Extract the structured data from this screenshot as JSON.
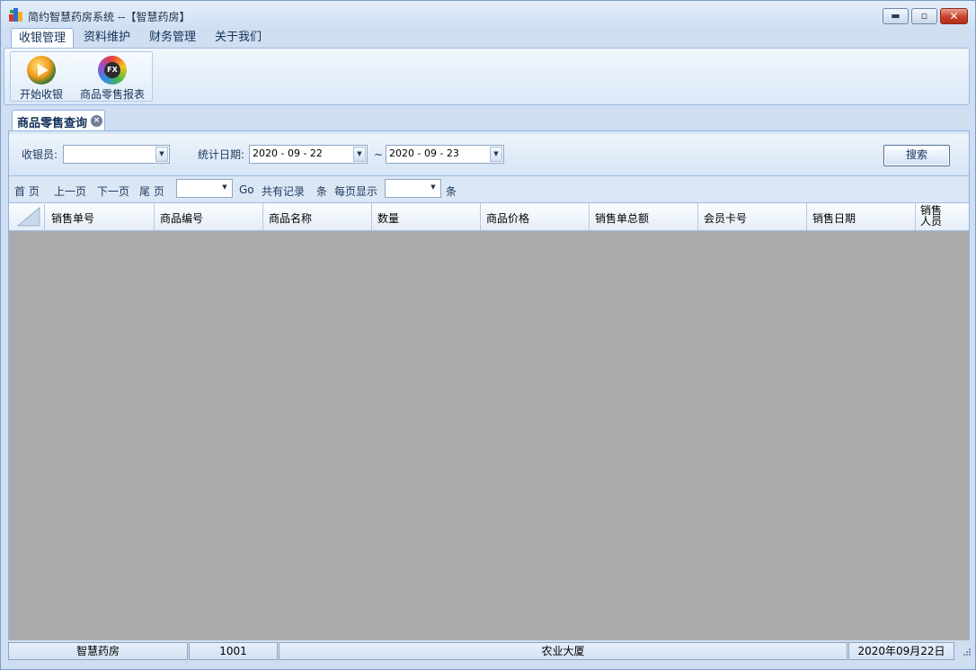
{
  "window": {
    "title": "简约智慧药房系统 --【智慧药房】",
    "minimize_glyph": "▬",
    "restore_glyph": "▫",
    "close_glyph": "✕"
  },
  "menu": {
    "tabs": [
      {
        "label": "收银管理",
        "active": true
      },
      {
        "label": "资料维护",
        "active": false
      },
      {
        "label": "财务管理",
        "active": false
      },
      {
        "label": "关于我们",
        "active": false
      }
    ]
  },
  "ribbon": {
    "buttons": [
      {
        "label": "开始收银",
        "icon": "play-icon"
      },
      {
        "label": "商品零售报表",
        "icon": "fx-report-icon",
        "icon_text": "FX"
      }
    ]
  },
  "document_tab": {
    "label": "商品零售查询",
    "close_glyph": "×"
  },
  "filter": {
    "cashier_label": "收银员:",
    "cashier_value": "",
    "date_label": "统计日期:",
    "date_from": "2020 - 09 - 22",
    "date_separator": "~",
    "date_to": "2020 - 09 - 23",
    "search_label": "搜索",
    "dropdown_glyph": "▼"
  },
  "pager": {
    "first": "首 页",
    "prev": "上一页",
    "next": "下一页",
    "last": "尾 页",
    "page_value": "",
    "go": "Go",
    "total_label": "共有记录",
    "unit1": "条",
    "per_page_label": "每页显示",
    "per_page_value": "",
    "unit2": "条"
  },
  "grid": {
    "columns": [
      "销售单号",
      "商品编号",
      "商品名称",
      "数量",
      "商品价格",
      "销售单总额",
      "会员卡号",
      "销售日期",
      "销售人员"
    ],
    "rows": []
  },
  "statusbar": {
    "store": "智慧药房",
    "user_id": "1001",
    "location": "农业大厦",
    "date": "2020年09月22日"
  },
  "colors": {
    "accent": "#1e395b",
    "grid_background": "#ababab",
    "close_button": "#c7412a"
  }
}
